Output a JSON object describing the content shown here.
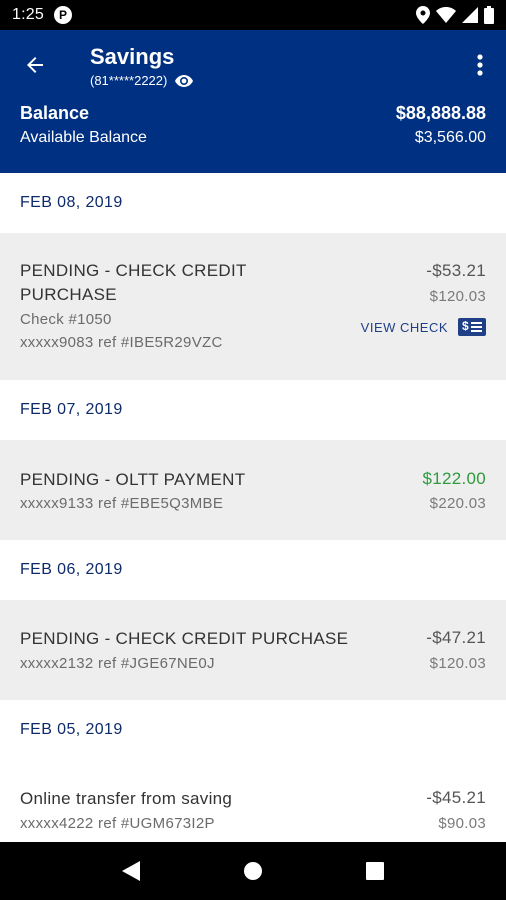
{
  "status": {
    "time": "1:25",
    "badge": "P"
  },
  "header": {
    "title": "Savings",
    "account_mask": "(81*****2222)",
    "balance_label": "Balance",
    "balance_value": "$88,888.88",
    "available_label": "Available Balance",
    "available_value": "$3,566.00"
  },
  "groups": [
    {
      "date": "FEB 08, 2019",
      "transactions": [
        {
          "description": "PENDING - CHECK CREDIT PURCHASE",
          "check_no": "Check #1050",
          "ref": "xxxxx9083 ref #IBE5R29VZC",
          "amount": "-$53.21",
          "running_balance": "$120.03",
          "view_check": "VIEW CHECK"
        }
      ]
    },
    {
      "date": "FEB 07, 2019",
      "transactions": [
        {
          "description": "PENDING - OLTT PAYMENT",
          "ref": "xxxxx9133 ref #EBE5Q3MBE",
          "amount": "$122.00",
          "running_balance": "$220.03"
        }
      ]
    },
    {
      "date": "FEB 06, 2019",
      "transactions": [
        {
          "description": "PENDING - CHECK CREDIT PURCHASE",
          "ref": "xxxxx2132 ref #JGE67NE0J",
          "amount": "-$47.21",
          "running_balance": "$120.03"
        }
      ]
    },
    {
      "date": "FEB 05, 2019",
      "transactions": [
        {
          "description": "Online transfer from saving",
          "ref": "xxxxx4222 ref #UGM673I2P",
          "amount": "-$45.21",
          "running_balance": "$90.03"
        }
      ]
    }
  ],
  "colors": {
    "header_bg": "#003082",
    "credit_amount": "#2e9b3c",
    "date_text": "#0d2a6b"
  }
}
